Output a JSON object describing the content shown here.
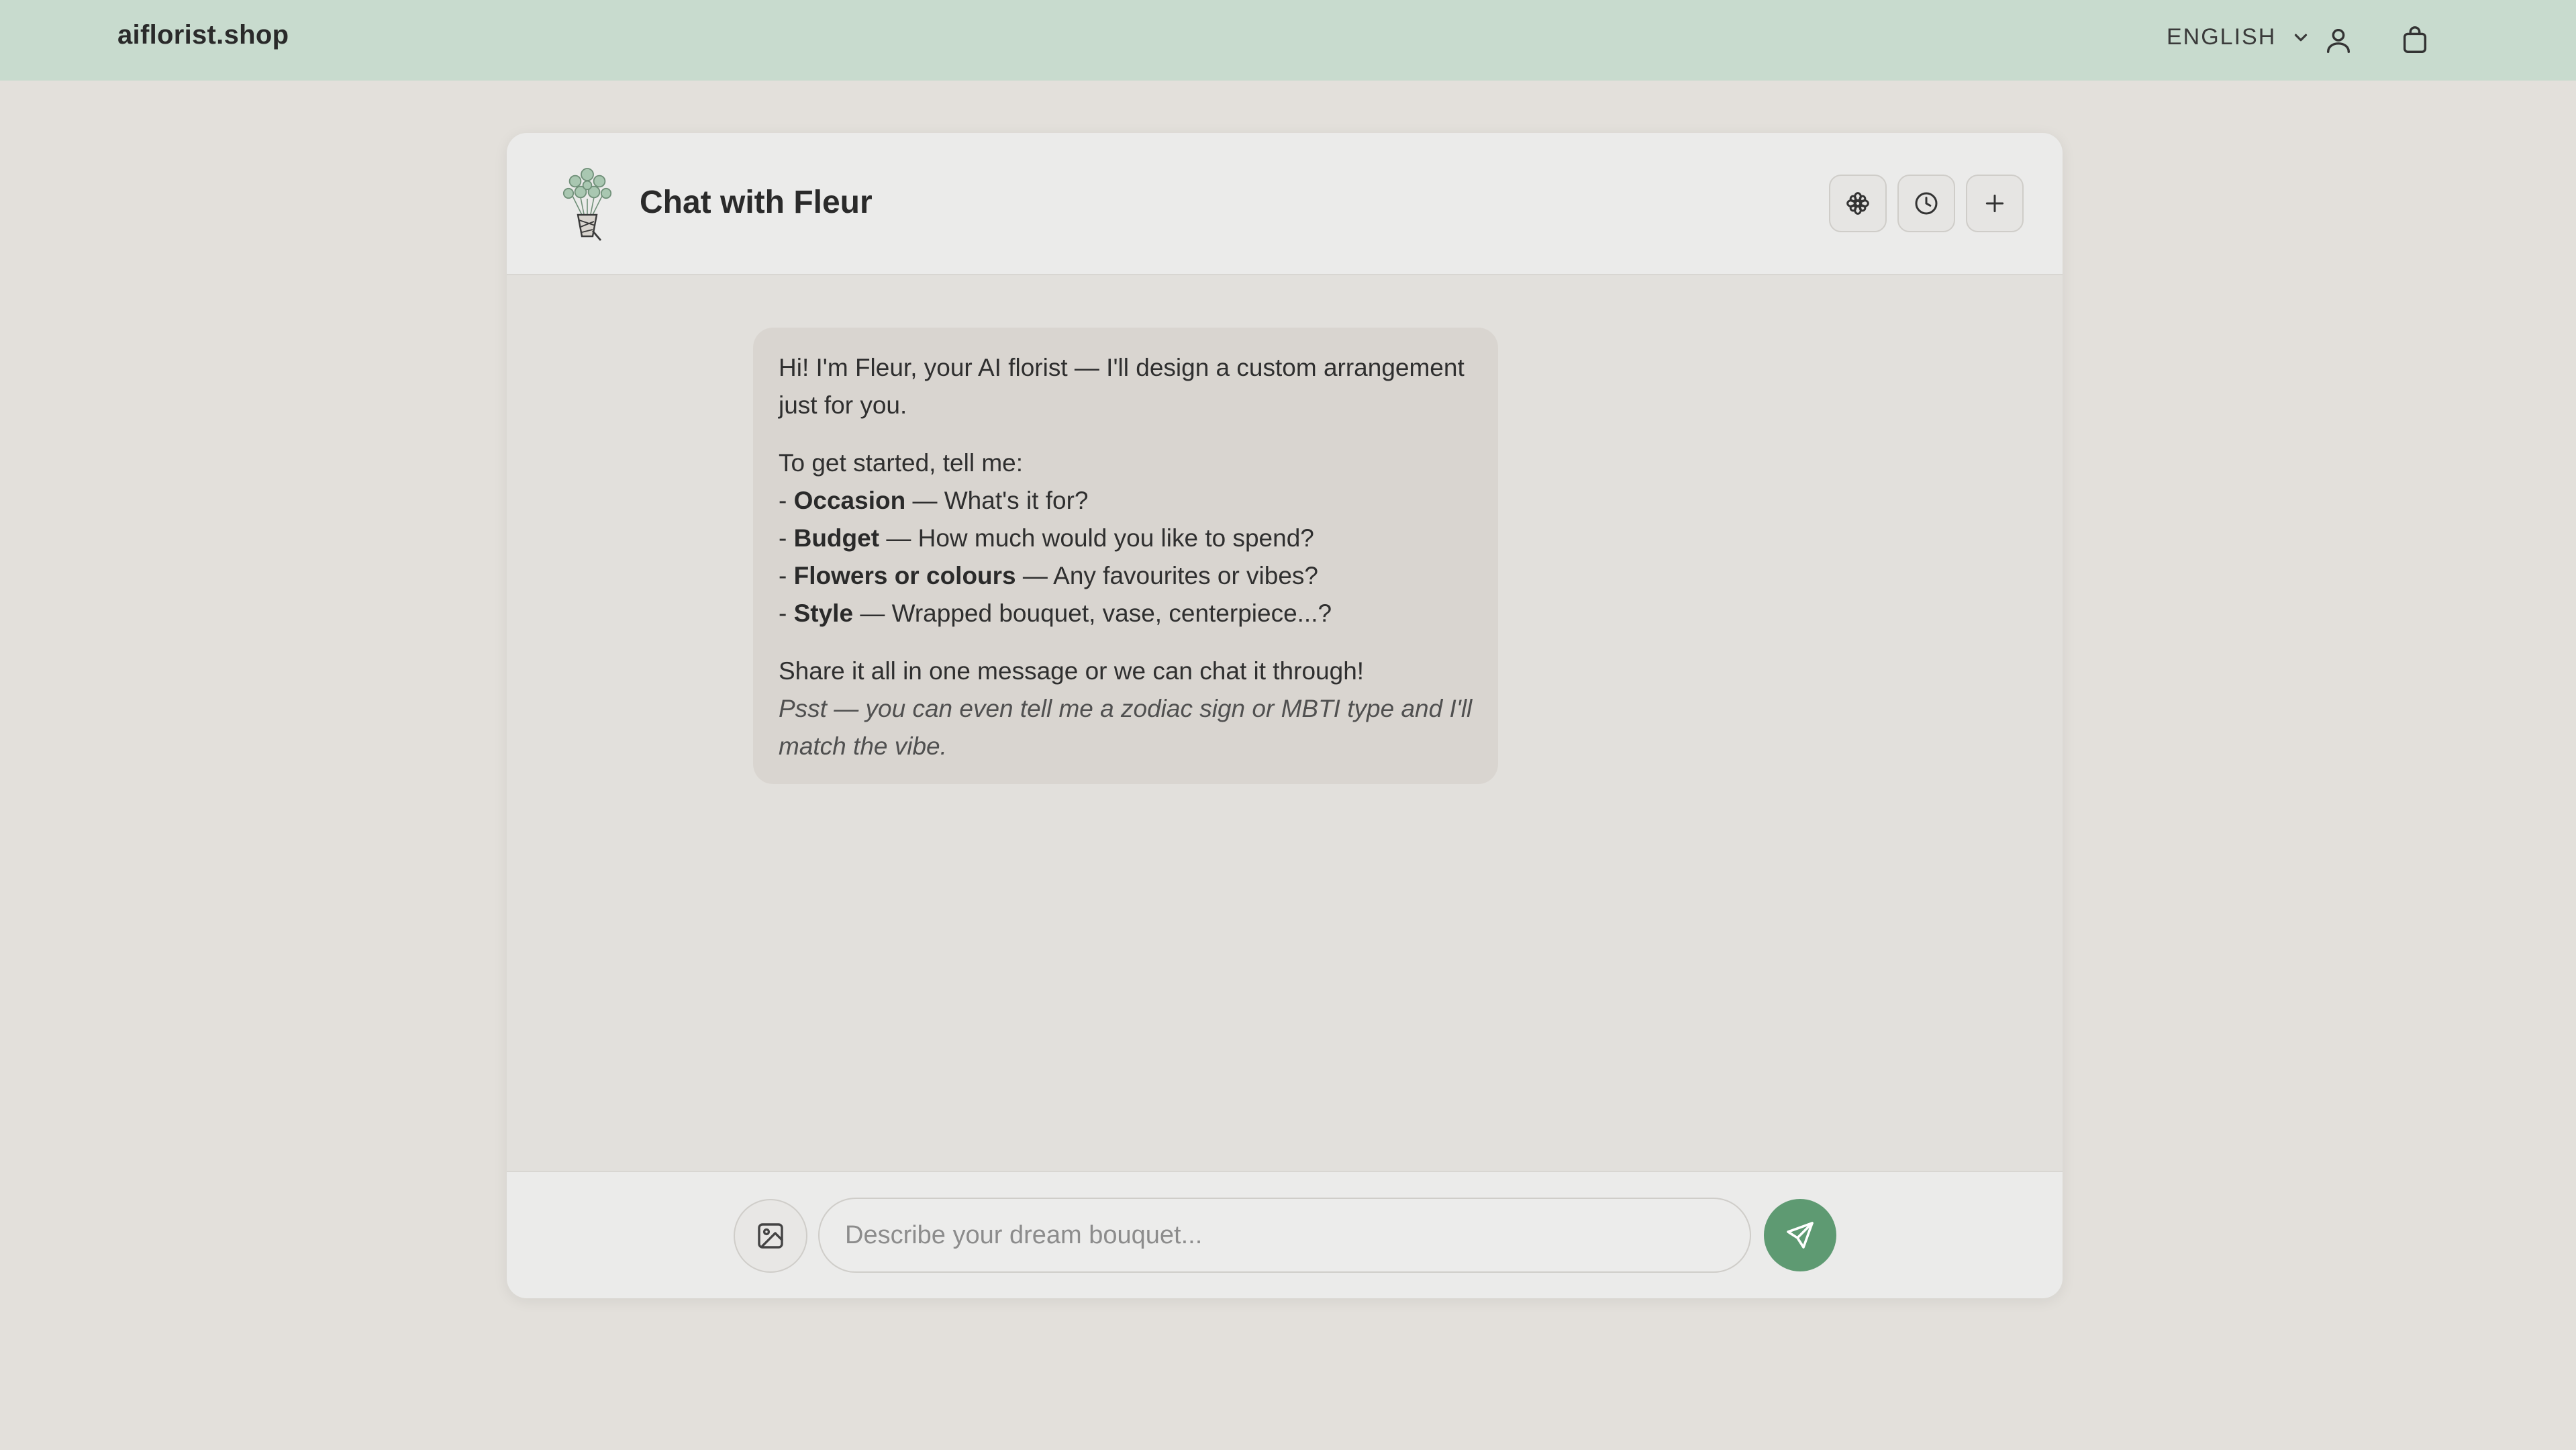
{
  "topbar": {
    "brand": "aiflorist.shop",
    "language": "ENGLISH",
    "icons": [
      "chevron-down-icon",
      "user-icon",
      "shopping-bag-icon"
    ]
  },
  "chat": {
    "title": "Chat with Fleur",
    "header_buttons": [
      "flower-icon",
      "history-clock-icon",
      "plus-icon"
    ],
    "message": {
      "intro": "Hi! I'm Fleur, your AI florist — I'll design a custom arrangement just for you.",
      "prompt": "To get started, tell me:",
      "items": [
        {
          "prefix": "- ",
          "label": "Occasion",
          "text": " — What's it for?"
        },
        {
          "prefix": "- ",
          "label": "Budget",
          "text": " — How much would you like to spend?"
        },
        {
          "prefix": "- ",
          "label": "Flowers or colours",
          "text": " — Any favourites or vibes?"
        },
        {
          "prefix": "- ",
          "label": "Style",
          "text": " — Wrapped bouquet, vase, centerpiece...?"
        }
      ],
      "share": "Share it all in one message or we can chat it through!",
      "psst": "Psst — you can even tell me a zodiac sign or MBTI type and I'll match the vibe."
    },
    "composer": {
      "placeholder": "Describe your dream bouquet...",
      "value": "",
      "icons": [
        "image-upload-icon",
        "send-icon"
      ]
    }
  },
  "colors": {
    "topbar_bg": "#c8dbce",
    "page_bg": "#e3e0db",
    "accent_send": "#5e9a72",
    "bubble_bg": "#d9d5d0"
  }
}
